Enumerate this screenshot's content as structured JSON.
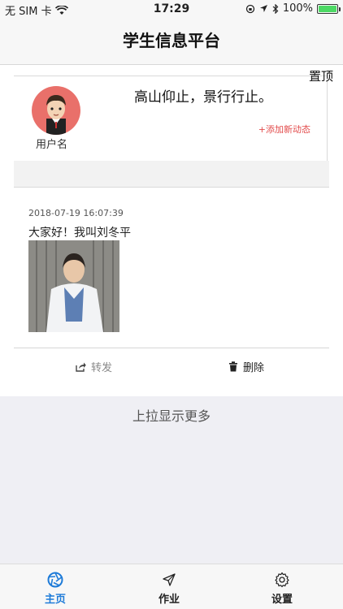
{
  "status_bar": {
    "carrier": "无 SIM 卡",
    "time": "17:29",
    "battery": "100%",
    "battery_level": 1.0
  },
  "nav": {
    "title": "学生信息平台"
  },
  "pin_label": "置顶",
  "profile": {
    "username": "用户名",
    "motto": "高山仰止，景行行止。",
    "add_post": "+添加新动态"
  },
  "post": {
    "timestamp": "2018-07-19 16:07:39",
    "text": "大家好！我叫刘冬平",
    "forward_label": "转发",
    "delete_label": "删除"
  },
  "load_more": "上拉显示更多",
  "tabs": [
    {
      "label": "主页",
      "icon": "aperture-icon",
      "active": true
    },
    {
      "label": "作业",
      "icon": "paper-plane-icon",
      "active": false
    },
    {
      "label": "设置",
      "icon": "gear-icon",
      "active": false
    }
  ],
  "colors": {
    "accent": "#1e7bd8",
    "add_post": "#e24b4b",
    "battery": "#4cd964"
  }
}
